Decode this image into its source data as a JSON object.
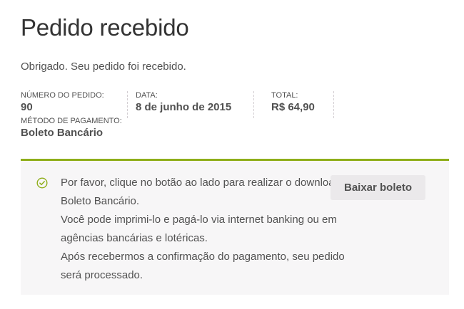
{
  "page": {
    "title": "Pedido recebido",
    "thanks": "Obrigado. Seu pedido foi recebido."
  },
  "order": {
    "number_label": "NÚMERO DO PEDIDO:",
    "number_value": "90",
    "date_label": "DATA:",
    "date_value": "8 de junho de 2015",
    "total_label": "TOTAL:",
    "total_value": "R$ 64,90",
    "method_label": "MÉTODO DE PAGAMENTO:",
    "method_value": "Boleto Bancário"
  },
  "notice": {
    "icon": "check-circle-icon",
    "accent_color": "#8fae1b",
    "line1": "Por favor, clique no botão ao lado para realizar o download do Boleto Bancário.",
    "line2": "Você pode imprimi-lo e pagá-lo via internet banking ou em agências bancárias e lotéricas.",
    "line3": "Após recebermos a confirmação do pagamento, seu pedido será processado.",
    "button_label": "Baixar boleto"
  }
}
